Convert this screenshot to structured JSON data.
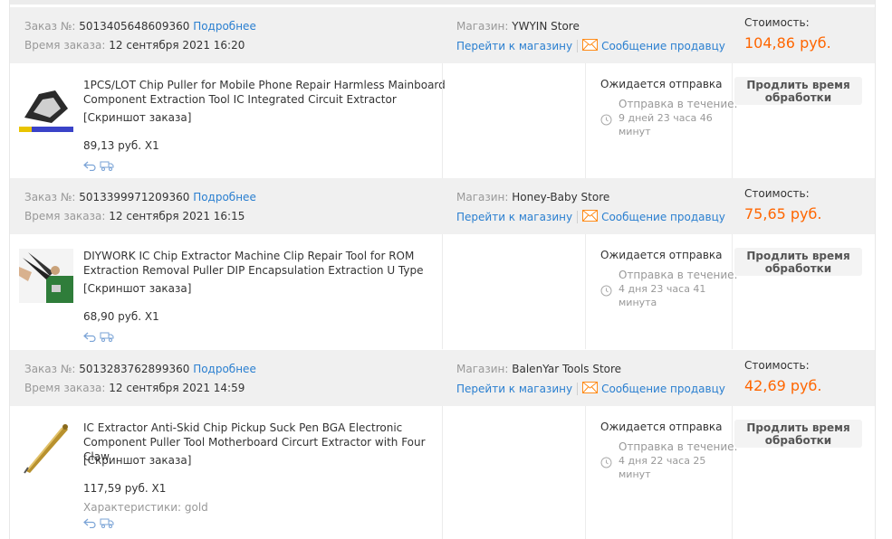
{
  "labels": {
    "order_no": "Заказ №:",
    "details": "Подробнее",
    "order_time": "Время заказа:",
    "store": "Магазин:",
    "go_to_store": "Перейти к магазину",
    "message_seller": "Сообщение продавцу",
    "cost": "Стоимость:",
    "screenshot": "[Скриншот заказа]",
    "awaiting_shipment": "Ожидается отправка",
    "ship_within": "Отправка в течение:",
    "extend_time": "Продлить время обработки",
    "characteristics": "Характеристики:"
  },
  "colors": {
    "link": "#2a7fd0",
    "price_accent": "#ff6600",
    "header_bg": "#f0f0f0"
  },
  "icons": [
    "mail-icon",
    "clock-icon",
    "return-icon",
    "delivery-truck-icon"
  ],
  "orders": [
    {
      "number": "5013405648609360",
      "time": "12 сентября 2021 16:20",
      "store": "YWYIN Store",
      "cost": "104,86 руб.",
      "item_title": "1PCS/LOT Chip Puller for Mobile Phone Repair Harmless Mainboard Component Extraction Tool IC Integrated Circuit Extractor",
      "item_price": "89,13 руб. X1",
      "ship_time": "9 дней 23 часа 46 минут",
      "props": ""
    },
    {
      "number": "5013399971209360",
      "time": "12 сентября 2021 16:15",
      "store": "Honey-Baby Store",
      "cost": "75,65 руб.",
      "item_title": "DIYWORK IC Chip Extractor Machine Clip Repair Tool for ROM Extraction Removal Puller DIP Encapsulation Extraction U Type",
      "item_price": "68,90 руб. X1",
      "ship_time": "4 дня 23 часа 41 минута",
      "props": ""
    },
    {
      "number": "5013283762899360",
      "time": "12 сентября 2021 14:59",
      "store": "BalenYar Tools Store",
      "cost": "42,69 руб.",
      "item_title": "IC Extractor Anti-Skid Chip Pickup Suck Pen BGA Electronic Component Puller Tool Motherboard Circurt Extractor with Four Claw",
      "item_price": "117,59 руб. X1",
      "ship_time": "4 дня 22 часа 25 минут",
      "props": "gold"
    }
  ]
}
